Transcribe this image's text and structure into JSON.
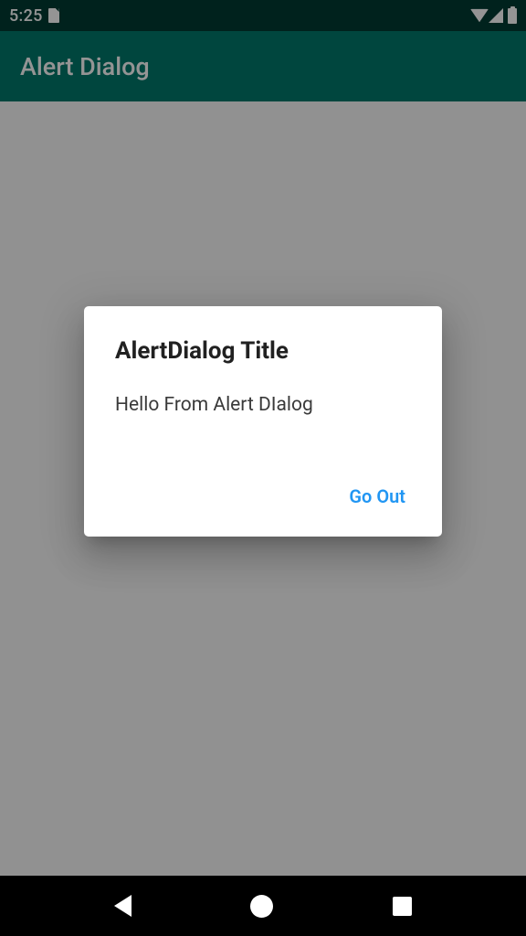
{
  "status_bar": {
    "time": "5:25"
  },
  "app_bar": {
    "title": "Alert Dialog"
  },
  "dialog": {
    "title": "AlertDialog Title",
    "message": "Hello From Alert DIalog",
    "confirm_label": "Go Out"
  }
}
